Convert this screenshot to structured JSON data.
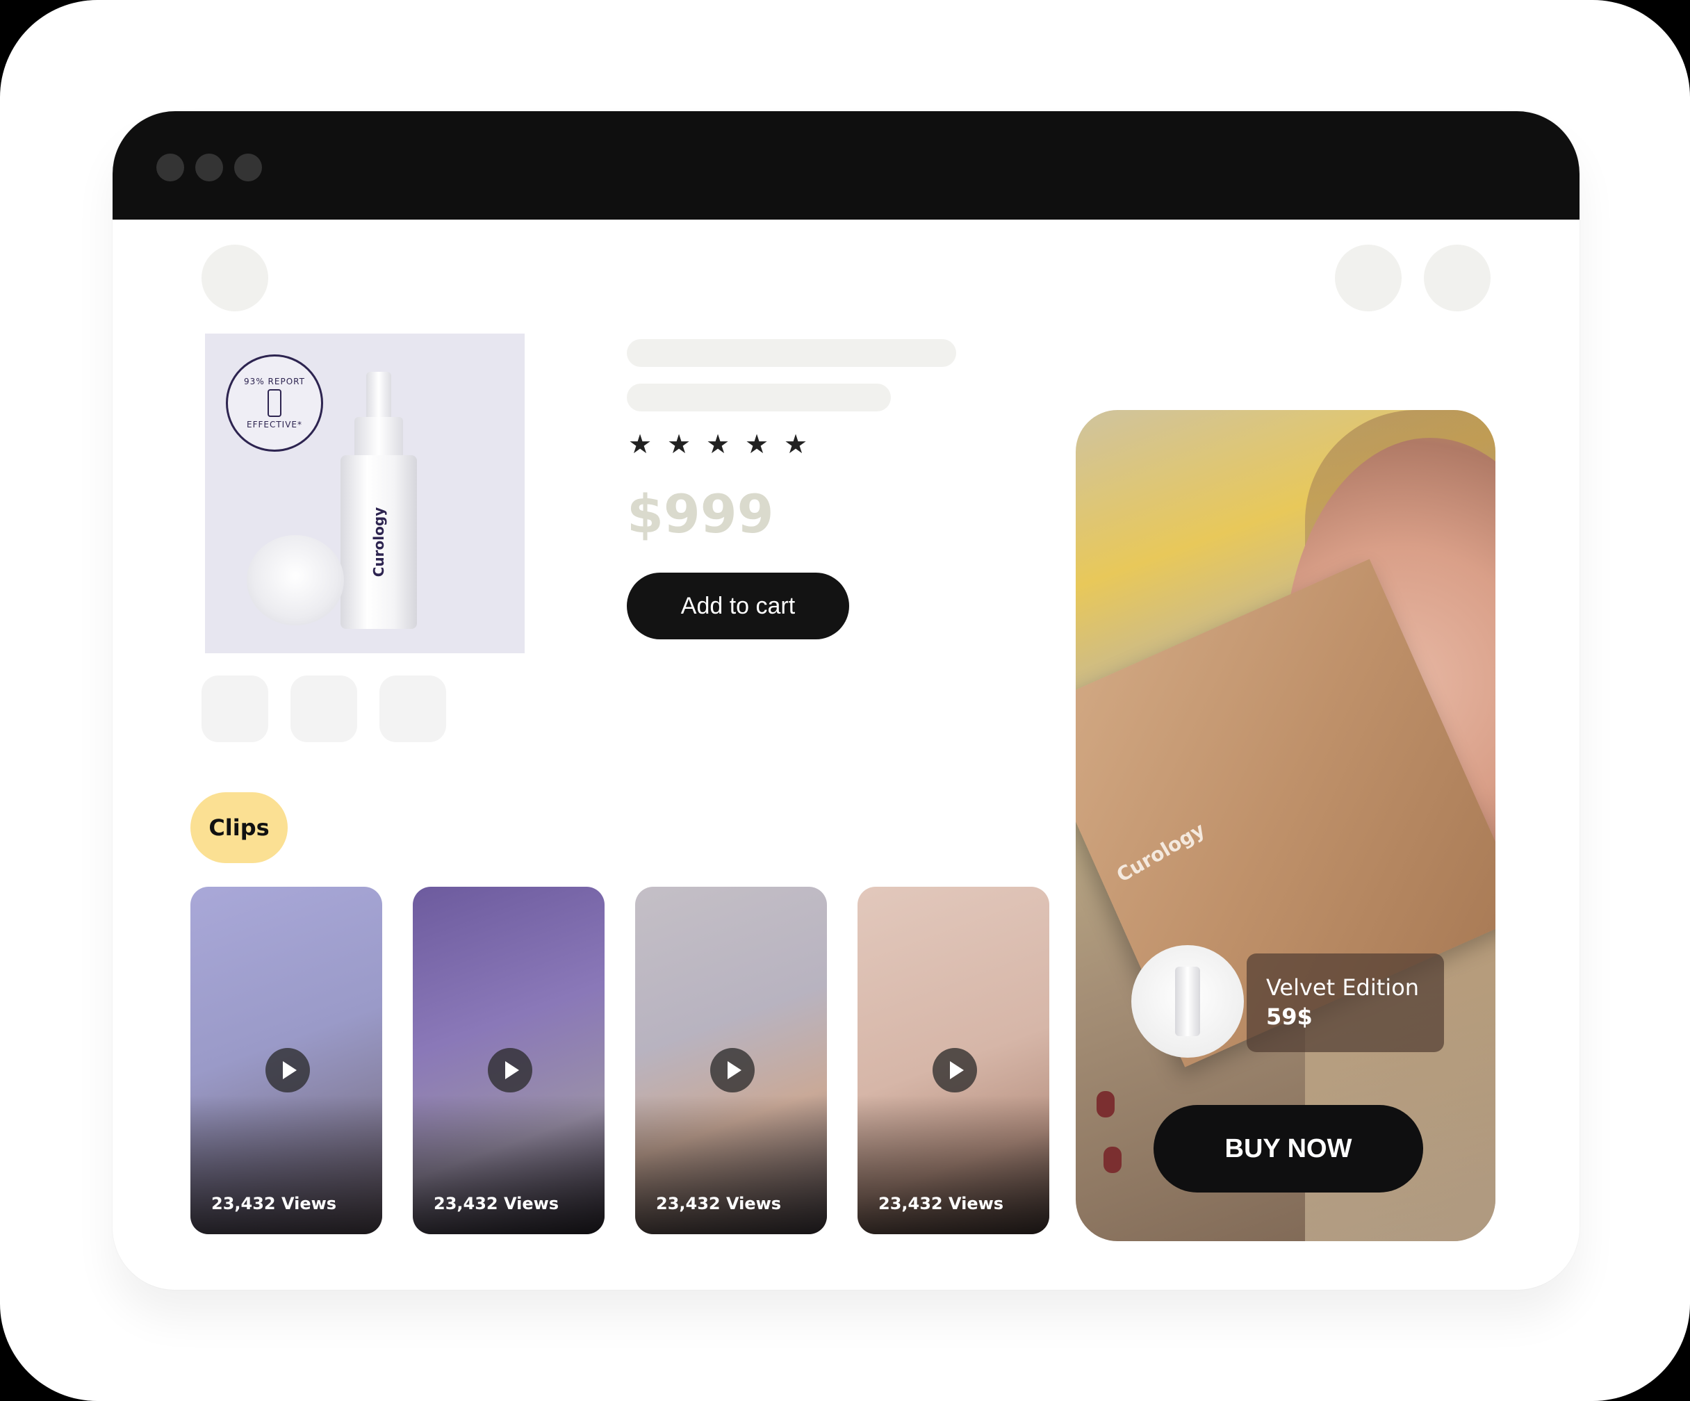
{
  "product": {
    "brand": "Curology",
    "badge_text_top": "93% REPORT",
    "badge_text_bottom": "EFFECTIVE*",
    "rating_stars": 5,
    "price": "$999",
    "add_to_cart_label": "Add to cart"
  },
  "clips": {
    "tag_label": "Clips",
    "items": [
      {
        "views": "23,432 Views",
        "bg": "#9a9ac8"
      },
      {
        "views": "23,432 Views",
        "bg": "#8a78b8"
      },
      {
        "views": "23,432 Views",
        "bg": "#b8b3c0"
      },
      {
        "views": "23,432 Views",
        "bg": "#d6b6a8"
      }
    ]
  },
  "feature": {
    "box_brand": "Curology",
    "product_name": "Velvet Edition",
    "product_price": "59$",
    "buy_label": "BUY NOW"
  },
  "colors": {
    "titlebar": "#0f0f0f",
    "clips_tag": "#fbe093",
    "price": "#dadacd",
    "button": "#131313"
  }
}
